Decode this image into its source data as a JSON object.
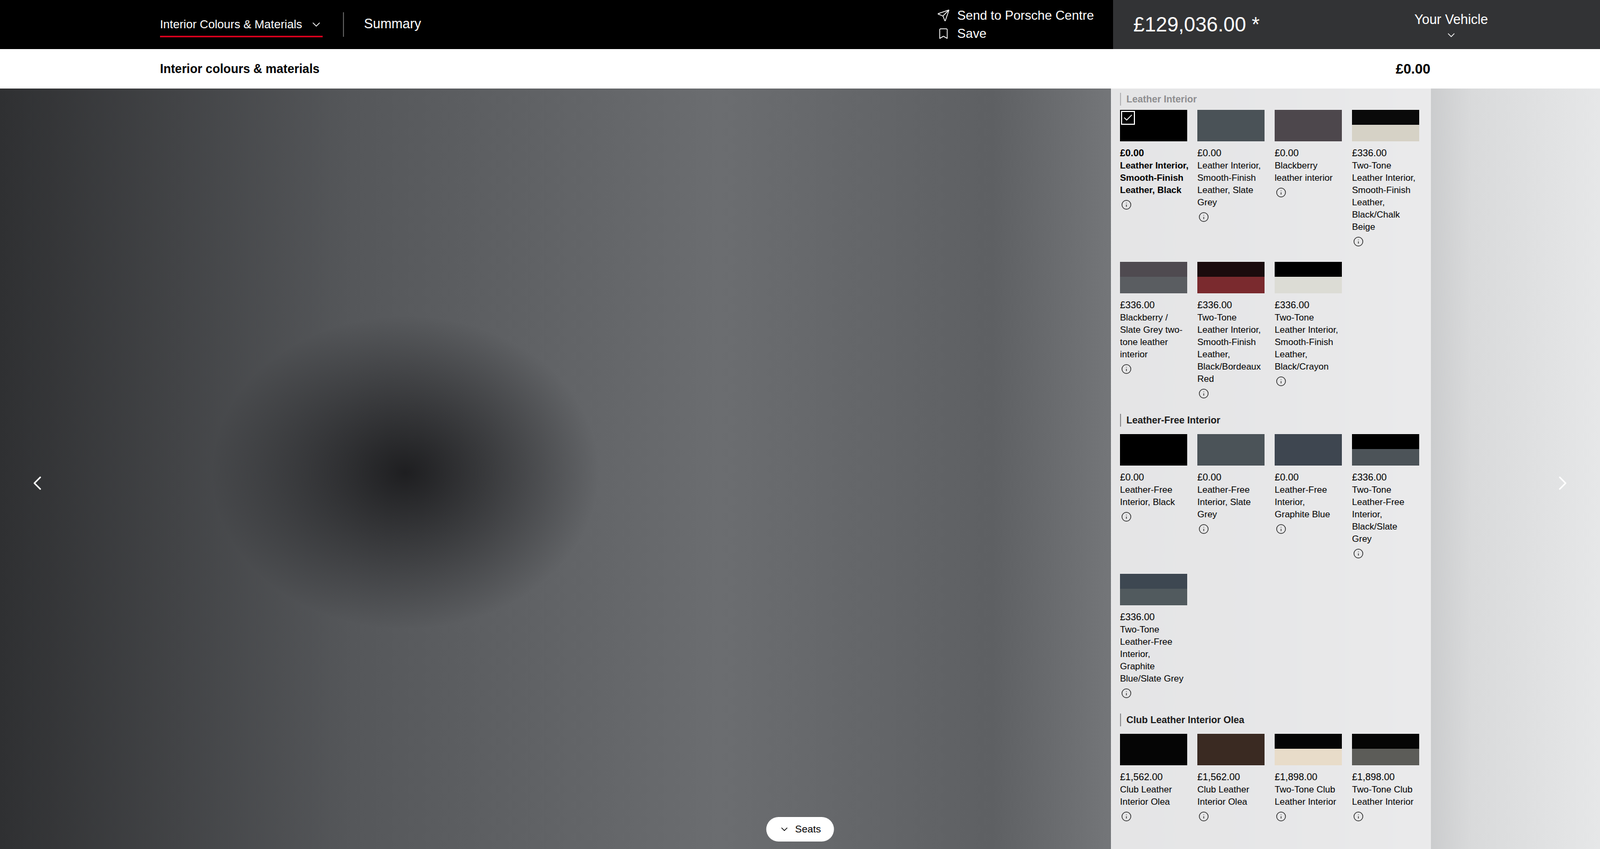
{
  "header": {
    "section_menu": {
      "label": "Interior Colours & Materials",
      "selected": true
    },
    "summary_tab": {
      "label": "Summary",
      "selected": false
    },
    "actions": [
      {
        "label": "Send to Porsche Centre",
        "kind": "send"
      },
      {
        "label": "Save",
        "kind": "save"
      }
    ],
    "price": "£129,036.00 *",
    "vehicle_menu": "Your Vehicle"
  },
  "subheader": {
    "title": "Interior colours & materials",
    "price": "£0.00"
  },
  "sections": [
    {
      "title": "Leather Interior",
      "faded": true,
      "options": [
        {
          "price": "£0.00",
          "label": [
            "Leather Interior,",
            "Smooth-Finish",
            "Leather, Black"
          ],
          "colors": [
            "#000000"
          ],
          "selected": true
        },
        {
          "price": "£0.00",
          "label": [
            "Leather Interior,",
            "Smooth-Finish",
            "Leather, Slate",
            "Grey"
          ],
          "colors": [
            "#4a5257"
          ],
          "selected": false
        },
        {
          "price": "£0.00",
          "label": [
            "Blackberry",
            "leather interior"
          ],
          "colors": [
            "#4d474c"
          ],
          "selected": false
        },
        {
          "price": "£336.00",
          "label": [
            "Two-Tone",
            "Leather Interior,",
            "Smooth-Finish",
            "Leather,",
            "Black/Chalk",
            "Beige"
          ],
          "colors": [
            "#0a0a0a",
            "#d6d2c6"
          ],
          "selected": false
        },
        {
          "price": "£336.00",
          "label": [
            "Blackberry /",
            "Slate Grey two-",
            "tone leather",
            "interior"
          ],
          "colors": [
            "#4f4a50",
            "#5a5d61"
          ],
          "selected": false
        },
        {
          "price": "£336.00",
          "label": [
            "Two-Tone",
            "Leather Interior,",
            "Smooth-Finish",
            "Leather,",
            "Black/Bordeaux",
            "Red"
          ],
          "colors": [
            "#1a0b0d",
            "#7a2a2e"
          ],
          "selected": false
        },
        {
          "price": "£336.00",
          "label": [
            "Two-Tone",
            "Leather Interior,",
            "Smooth-Finish",
            "Leather,",
            "Black/Crayon"
          ],
          "colors": [
            "#000000",
            "#dcdcd5"
          ],
          "selected": false
        }
      ]
    },
    {
      "title": "Leather-Free Interior",
      "faded": false,
      "options": [
        {
          "price": "£0.00",
          "label": [
            "Leather-Free",
            "Interior, Black"
          ],
          "colors": [
            "#000000"
          ],
          "selected": false
        },
        {
          "price": "£0.00",
          "label": [
            "Leather-Free",
            "Interior, Slate",
            "Grey"
          ],
          "colors": [
            "#4b5358"
          ],
          "selected": false
        },
        {
          "price": "£0.00",
          "label": [
            "Leather-Free",
            "Interior,",
            "Graphite Blue"
          ],
          "colors": [
            "#3e4650"
          ],
          "selected": false
        },
        {
          "price": "£336.00",
          "label": [
            "Two-Tone",
            "Leather-Free",
            "Interior,",
            "Black/Slate",
            "Grey"
          ],
          "colors": [
            "#000000",
            "#4c5358"
          ],
          "selected": false
        },
        {
          "price": "£336.00",
          "label": [
            "Two-Tone",
            "Leather-Free",
            "Interior,",
            "Graphite",
            "Blue/Slate Grey"
          ],
          "colors": [
            "#3d4751",
            "#515a5e"
          ],
          "selected": false
        }
      ]
    },
    {
      "title": "Club Leather Interior Olea",
      "faded": false,
      "options": [
        {
          "price": "£1,562.00",
          "label": [
            "Club Leather",
            "Interior Olea"
          ],
          "colors": [
            "#050505"
          ],
          "selected": false
        },
        {
          "price": "£1,562.00",
          "label": [
            "Club Leather",
            "Interior Olea"
          ],
          "colors": [
            "#3a2a22"
          ],
          "selected": false
        },
        {
          "price": "£1,898.00",
          "label": [
            "Two-Tone Club",
            "Leather Interior"
          ],
          "colors": [
            "#050505",
            "#e8dcc9"
          ],
          "selected": false
        },
        {
          "price": "£1,898.00",
          "label": [
            "Two-Tone Club",
            "Leather Interior"
          ],
          "colors": [
            "#050505",
            "#5c5c58"
          ],
          "selected": false
        }
      ]
    }
  ],
  "seats_button": "Seats"
}
